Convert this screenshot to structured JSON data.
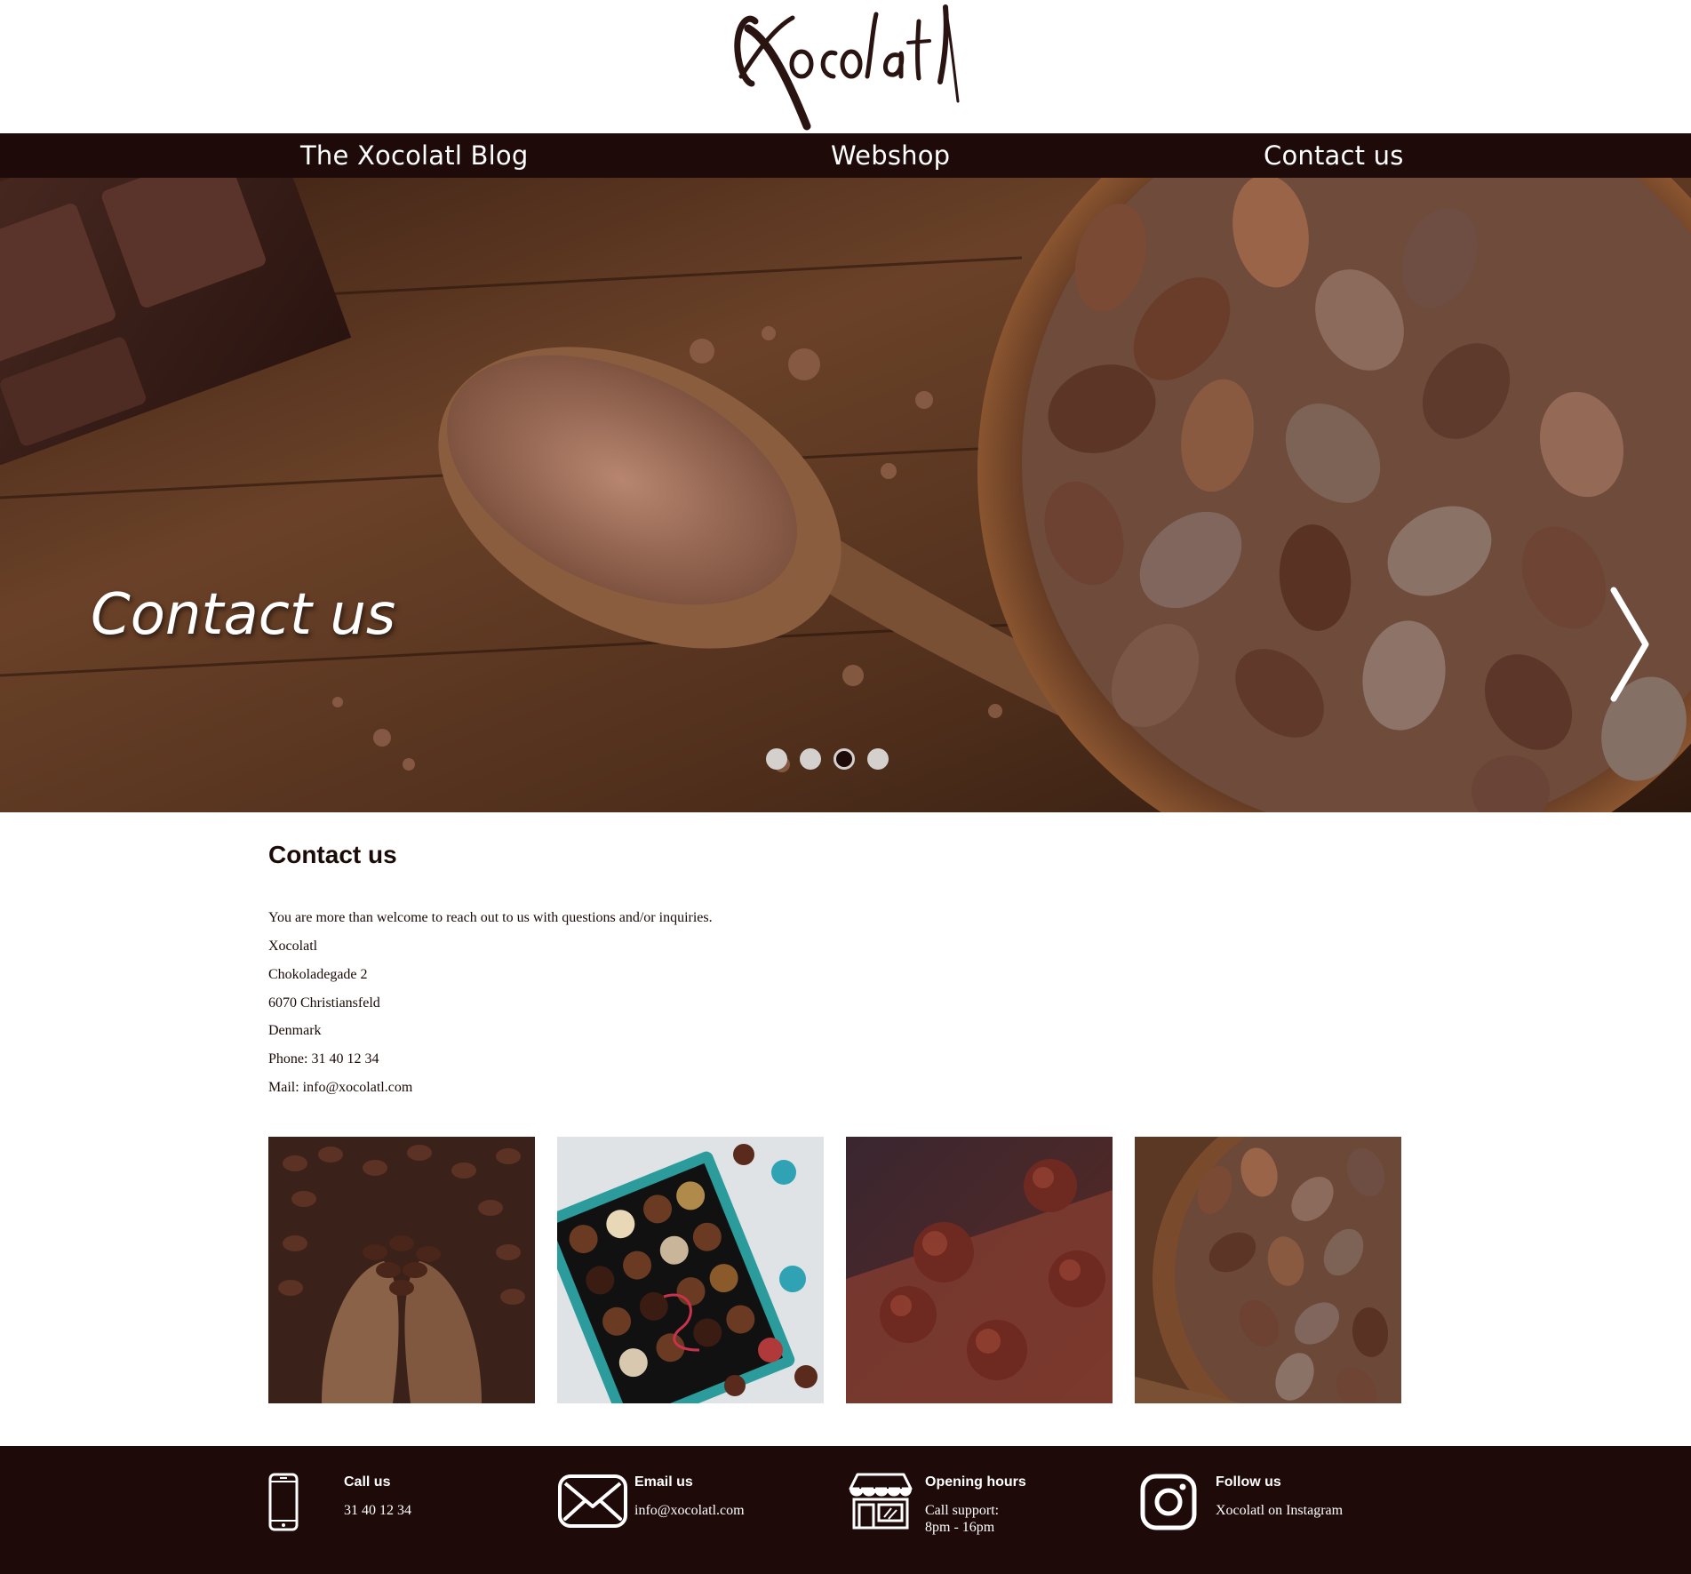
{
  "brand": {
    "logo_text": "Xocolatl"
  },
  "nav": {
    "items": [
      {
        "label": "The Xocolatl Blog"
      },
      {
        "label": "Webshop"
      },
      {
        "label": "Contact us"
      }
    ]
  },
  "hero": {
    "title": "Contact us",
    "next_glyph": "❭",
    "slides_total": 4,
    "active_slide": 3
  },
  "main": {
    "title": "Contact us",
    "intro": "You are more than welcome to reach out to us with questions and/or inquiries.",
    "address": {
      "name": "Xocolatl",
      "street": "Chokoladegade 2",
      "city": "6070 Christiansfeld",
      "country": "Denmark"
    },
    "phone_line": "Phone: 31 40 12 34",
    "mail_line": "Mail: info@xocolatl.com"
  },
  "gallery": {
    "images": [
      {
        "icon": "cocoa-beans-in-hands"
      },
      {
        "icon": "chocolate-box"
      },
      {
        "icon": "truffles"
      },
      {
        "icon": "cocoa-bowl"
      }
    ]
  },
  "footer": {
    "call": {
      "heading": "Call us",
      "text": "31 40 12 34",
      "icon": "phone-icon"
    },
    "email": {
      "heading": "Email us",
      "text": "info@xocolatl.com",
      "icon": "envelope-icon"
    },
    "hours": {
      "heading": "Opening hours",
      "text1": "Call support:",
      "text2": "8pm - 16pm",
      "icon": "store-icon"
    },
    "follow": {
      "heading": "Follow us",
      "text": "Xocolatl on Instagram",
      "icon": "instagram-icon"
    }
  },
  "colors": {
    "dark_brown": "#1e0a09",
    "dot_inactive": "#d4d0cd",
    "text": "#1a0a08"
  }
}
